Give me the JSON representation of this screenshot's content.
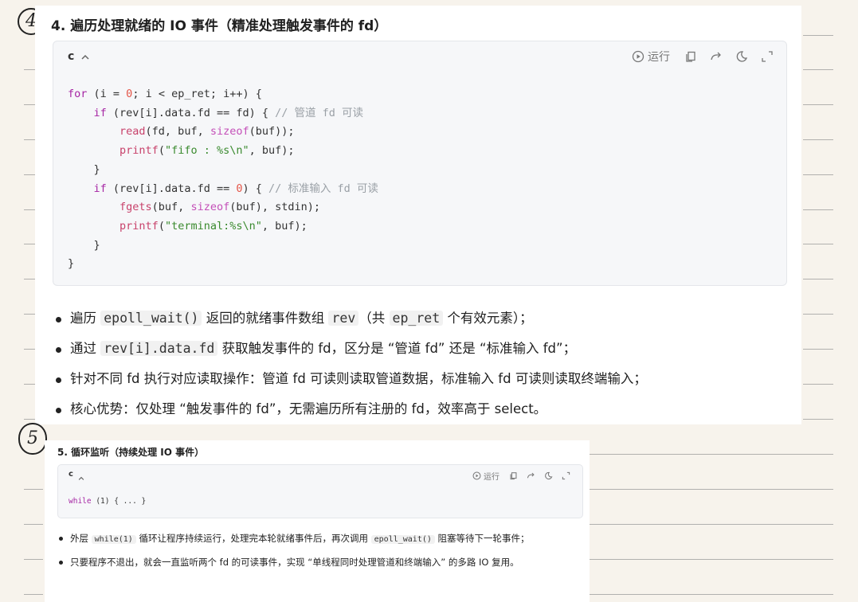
{
  "section4": {
    "circle_label": "4",
    "title": "4. 遍历处理就绪的 IO 事件（精准处理触发事件的 fd）",
    "code": {
      "lang": "c",
      "chevron_icon": "chevron-up-icon",
      "run_label": "运行",
      "tool_icons": [
        "play-circle-icon",
        "copy-icon",
        "share-icon",
        "theme-icon",
        "expand-icon"
      ],
      "lines": [
        "for (i = 0; i < ep_ret; i++) {",
        "    if (rev[i].data.fd == fd) { // 管道 fd 可读",
        "        read(fd, buf, sizeof(buf));",
        "        printf(\"fifo : %s\\n\", buf);",
        "    }",
        "    if (rev[i].data.fd == 0) { // 标准输入 fd 可读",
        "        fgets(buf, sizeof(buf), stdin);",
        "        printf(\"terminal:%s\\n\", buf);",
        "    }",
        "}"
      ]
    },
    "bullets": [
      {
        "t1": "遍历 ",
        "c1": "epoll_wait()",
        "t2": " 返回的就绪事件数组 ",
        "c2": "rev",
        "t3": "（共 ",
        "c3": "ep_ret",
        "t4": " 个有效元素）；"
      },
      {
        "t1": "通过 ",
        "c1": "rev[i].data.fd",
        "t2": " 获取触发事件的 fd，区分是 “管道 fd” 还是 “标准输入 fd”；"
      },
      {
        "t1": "针对不同 fd 执行对应读取操作：管道 fd 可读则读取管道数据，标准输入 fd 可读则读取终端输入；"
      },
      {
        "t1": "核心优势：仅处理 “触发事件的 fd”，无需遍历所有注册的 fd，效率高于 select。"
      }
    ]
  },
  "section5": {
    "circle_label": "5",
    "title": "5. 循环监听（持续处理 IO 事件）",
    "code": {
      "lang": "c",
      "run_label": "运行",
      "line_kw": "while",
      "line_rest": " (1) { ... }"
    },
    "bullets": [
      {
        "t1": "外层 ",
        "c1": "while(1)",
        "t2": " 循环让程序持续运行，处理完本轮就绪事件后，再次调用 ",
        "c2": "epoll_wait()",
        "t3": " 阻塞等待下一轮事件；"
      },
      {
        "t1": "只要程序不退出，就会一直监听两个 fd 的可读事件，实现 “单线程同时处理管道和终端输入” 的多路 IO 复用。"
      }
    ]
  }
}
